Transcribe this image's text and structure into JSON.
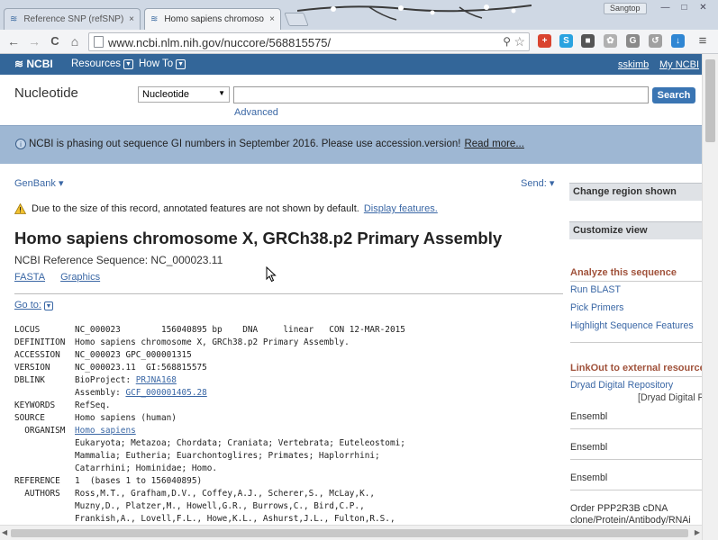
{
  "browser": {
    "tabs": [
      {
        "title": "Reference SNP (refSNP) C",
        "close": "×"
      },
      {
        "title": "Homo sapiens chromoso",
        "close": "×"
      }
    ],
    "user_badge": "Sangtop",
    "window_controls": {
      "minimize": "—",
      "maximize": "□",
      "close": "✕"
    },
    "nav": {
      "back": "←",
      "forward": "→",
      "reload": "C",
      "home": "⌂"
    },
    "url": "www.ncbi.nlm.nih.gov/nuccore/568815575/",
    "zoom_glyph": "⚲",
    "star_glyph": "☆",
    "extensions": [
      {
        "name": "plus-extension-icon",
        "glyph": "+",
        "color": "#d9442f"
      },
      {
        "name": "skype-extension-icon",
        "glyph": "S",
        "color": "#2aa3e0"
      },
      {
        "name": "puzzle-extension-icon",
        "glyph": "■",
        "color": "#555555"
      },
      {
        "name": "flower-extension-icon",
        "glyph": "✿",
        "color": "#b0b0b0"
      },
      {
        "name": "g-extension-icon",
        "glyph": "G",
        "color": "#8a8a8a"
      },
      {
        "name": "arrow-extension-icon",
        "glyph": "↺",
        "color": "#a0a0a0"
      },
      {
        "name": "download-extension-icon",
        "glyph": "↓",
        "color": "#2f86d3"
      }
    ],
    "menu_glyph": "≡"
  },
  "ncbi": {
    "logo": "NCBI",
    "menus": [
      "Resources",
      "How To"
    ],
    "user": "sskimb",
    "my_ncbi": "My NCBI"
  },
  "search": {
    "db_title": "Nucleotide",
    "db_selected": "Nucleotide",
    "query": "",
    "button": "Search",
    "advanced": "Advanced"
  },
  "banner": {
    "message": "NCBI is phasing out sequence GI numbers in September 2016. Please use accession.version!",
    "link": "Read more..."
  },
  "record": {
    "format": "GenBank",
    "send": "Send:",
    "warning": "Due to the size of this record, annotated features are not shown by default.",
    "warning_link": "Display features.",
    "title": "Homo sapiens chromosome X, GRCh38.p2 Primary Assembly",
    "refseq": "NCBI Reference Sequence: NC_000023.11",
    "links": [
      "FASTA",
      "Graphics"
    ],
    "goto": "Go to:",
    "genbank": [
      {
        "key": "LOCUS",
        "value": "NC_000023        156040895 bp    DNA     linear   CON 12-MAR-2015"
      },
      {
        "key": "DEFINITION",
        "value": "Homo sapiens chromosome X, GRCh38.p2 Primary Assembly."
      },
      {
        "key": "ACCESSION",
        "value": "NC_000023 GPC_000001315"
      },
      {
        "key": "VERSION",
        "value": "NC_000023.11  GI:568815575"
      },
      {
        "key": "DBLINK",
        "value": "BioProject: ",
        "link": "PRJNA168"
      },
      {
        "key": "",
        "value": "Assembly: ",
        "link": "GCF_000001405.28"
      },
      {
        "key": "KEYWORDS",
        "value": "RefSeq."
      },
      {
        "key": "SOURCE",
        "value": "Homo sapiens (human)"
      },
      {
        "key": "  ORGANISM",
        "value": "",
        "link": "Homo sapiens"
      },
      {
        "key": "",
        "value": "Eukaryota; Metazoa; Chordata; Craniata; Vertebrata; Euteleostomi;"
      },
      {
        "key": "",
        "value": "Mammalia; Eutheria; Euarchontoglires; Primates; Haplorrhini;"
      },
      {
        "key": "",
        "value": "Catarrhini; Hominidae; Homo."
      },
      {
        "key": "REFERENCE",
        "value": "1  (bases 1 to 156040895)"
      },
      {
        "key": "  AUTHORS",
        "value": "Ross,M.T., Grafham,D.V., Coffey,A.J., Scherer,S., McLay,K.,"
      },
      {
        "key": "",
        "value": "Muzny,D., Platzer,M., Howell,G.R., Burrows,C., Bird,C.P.,"
      },
      {
        "key": "",
        "value": "Frankish,A., Lovell,F.L., Howe,K.L., Ashurst,J.L., Fulton,R.S.,"
      }
    ]
  },
  "sidebar": {
    "change_region": "Change region shown",
    "customize_view": "Customize view",
    "analyze_title": "Analyze this sequence",
    "analyze_links": [
      "Run BLAST",
      "Pick Primers",
      "Highlight Sequence Features"
    ],
    "linkout_title": "LinkOut to external resources",
    "linkout_items": [
      {
        "label": "Dryad Digital Repository",
        "sub": "[Dryad Digital R"
      },
      {
        "label": "Ensembl",
        "sub": ""
      },
      {
        "label": "Ensembl",
        "sub": ""
      },
      {
        "label": "Ensembl",
        "sub": ""
      },
      {
        "label": "Order PPP2R3B cDNA",
        "sub": "clone/Protein/Antibody/RNAi"
      }
    ]
  },
  "colors": {
    "ncbi_blue": "#336699",
    "banner": "#9eb7d3",
    "link": "#3a67a5",
    "accent_title": "#a0523b"
  }
}
